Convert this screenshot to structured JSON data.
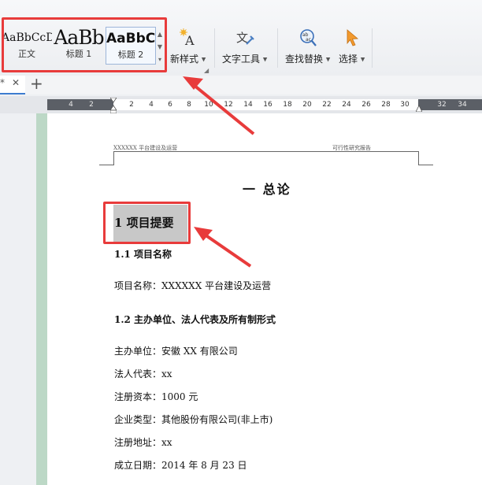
{
  "ribbon": {
    "style_gallery": [
      {
        "preview": "AaBbCcDd",
        "label": "正文"
      },
      {
        "preview": "AaBb",
        "label": "标题 1"
      },
      {
        "preview": "AaBbC",
        "label": "标题 2"
      }
    ],
    "buttons": {
      "new_style": "新样式",
      "text_tools": "文字工具",
      "find_replace": "查找替换",
      "select": "选择"
    },
    "icons": {
      "new_style": "new-style-icon",
      "text_tools": "text-tools-icon",
      "find_replace": "find-replace-icon",
      "select": "select-cursor-icon"
    }
  },
  "tabs": {
    "modified_mark": "*",
    "close": "✕",
    "new": "+"
  },
  "ruler": {
    "numbers": [
      "4",
      "2",
      "2",
      "4",
      "6",
      "8",
      "10",
      "12",
      "14",
      "16",
      "18",
      "20",
      "22",
      "24",
      "26",
      "28",
      "30",
      "32",
      "34"
    ]
  },
  "document": {
    "header_left": "XXXXXX 平台建设及运营",
    "header_right": "可行性研究报告",
    "chapter_title": "一 总论",
    "heading1": "1  项目提要",
    "sections": [
      {
        "heading": "1.1 项目名称",
        "lines": [
          "项目名称：XXXXXX 平台建设及运营"
        ]
      },
      {
        "heading": "1.2 主办单位、法人代表及所有制形式",
        "lines": [
          "主办单位：安徽 XX 有限公司",
          "法人代表：xx",
          "注册资本：1000 元",
          "企业类型：其他股份有限公司(非上市)",
          "注册地址：xx",
          "成立日期：2014 年 8 月 23 日"
        ]
      }
    ]
  },
  "colors": {
    "annotation_red": "#e83b3b",
    "tab_accent": "#3d7cd0",
    "highlight_gray": "#c8c8c8"
  }
}
